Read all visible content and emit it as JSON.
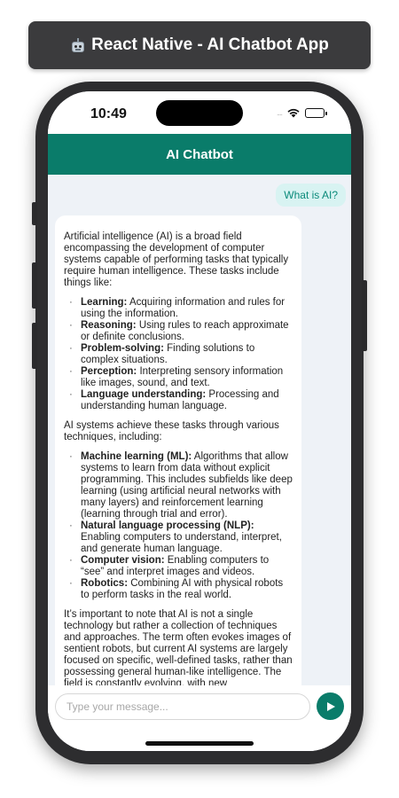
{
  "banner": {
    "icon": "robot-icon",
    "title": "React Native - AI Chatbot App"
  },
  "status_bar": {
    "time": "10:49",
    "signal": "....",
    "wifi_icon": "wifi-icon",
    "battery_icon": "battery-icon"
  },
  "header": {
    "title": "AI Chatbot",
    "color": "#0a7c6a"
  },
  "messages": {
    "user": "What is AI?",
    "bot": {
      "intro": "Artificial intelligence (AI) is a broad field encompassing the development of computer systems capable of performing tasks that typically require human intelligence.  These tasks include things like:",
      "tasks": [
        {
          "term": "Learning:",
          "desc": " Acquiring information and rules for using the information."
        },
        {
          "term": "Reasoning:",
          "desc": " Using rules to reach approximate or definite conclusions."
        },
        {
          "term": "Problem-solving:",
          "desc": " Finding solutions to complex situations."
        },
        {
          "term": "Perception:",
          "desc": " Interpreting sensory information like images, sound, and text."
        },
        {
          "term": "Language understanding:",
          "desc": " Processing and understanding human language."
        }
      ],
      "techniques_intro": "AI systems achieve these tasks through various techniques, including:",
      "techniques": [
        {
          "term": "Machine learning (ML):",
          "desc": " Algorithms that allow systems to learn from data without explicit programming. This includes subfields like deep learning (using artificial neural networks with many layers) and reinforcement learning (learning through trial and error)."
        },
        {
          "term": "Natural language processing (NLP):",
          "desc": " Enabling computers to understand, interpret, and generate human language."
        },
        {
          "term": "Computer vision:",
          "desc": " Enabling computers to “see” and interpret images and videos."
        },
        {
          "term": "Robotics:",
          "desc": " Combining AI with physical robots to perform tasks in the real world."
        }
      ],
      "closing": "It’s important to note that AI is not a single technology but rather a collection of techniques and approaches.  The term often evokes images of sentient robots, but current AI systems are largely focused on specific, well-defined tasks, rather than possessing general human-like intelligence.  The field is constantly evolving, with new"
    }
  },
  "input": {
    "placeholder": "Type your message...",
    "value": "",
    "send_icon": "send-icon"
  },
  "colors": {
    "accent": "#0a7c6a",
    "user_bubble_bg": "#d8f3f2",
    "user_bubble_text": "#0a8a7a",
    "chat_bg": "#eef2f7"
  }
}
